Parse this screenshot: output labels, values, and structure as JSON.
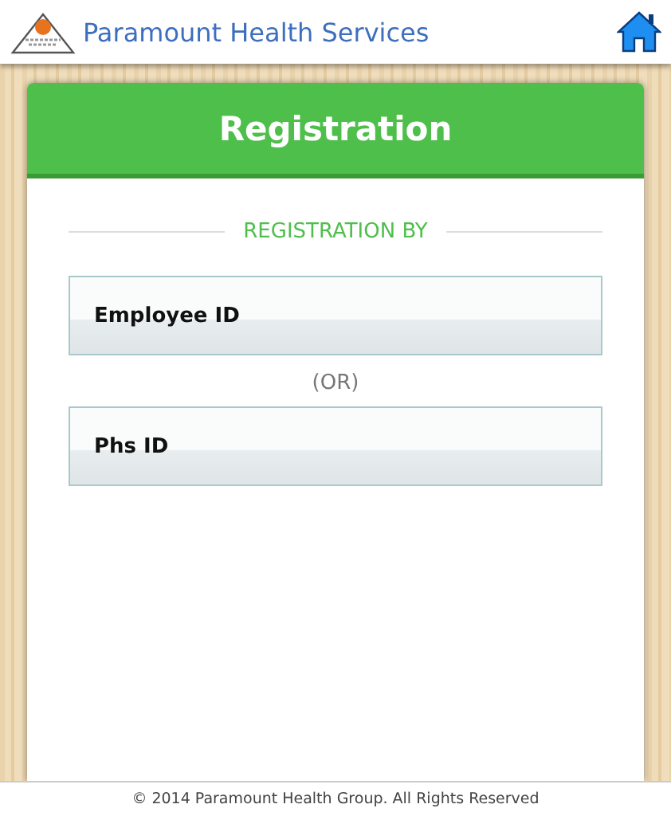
{
  "header": {
    "title": "Paramount Health Services"
  },
  "card": {
    "title": "Registration",
    "section_label": "REGISTRATION BY",
    "options": [
      {
        "label": "Employee ID"
      },
      {
        "label": "Phs ID"
      }
    ],
    "separator": "(OR)"
  },
  "footer": "© 2014 Paramount Health Group. All Rights Reserved"
}
